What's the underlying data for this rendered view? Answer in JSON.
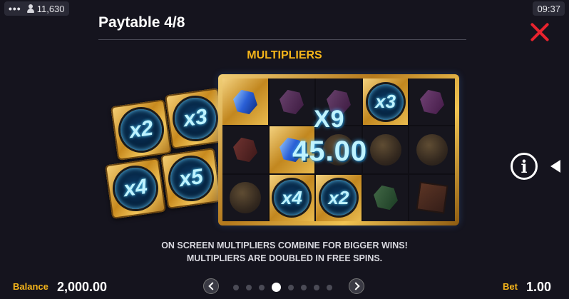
{
  "status": {
    "dots": "•••",
    "credits": "11,630",
    "time": "09:37"
  },
  "header": {
    "title": "Paytable 4/8"
  },
  "section": {
    "heading": "MULTIPLIERS"
  },
  "symbols": {
    "x2": "x2",
    "x3": "x3",
    "x4": "x4",
    "x5": "x5"
  },
  "win": {
    "multiplier": "X9",
    "amount": "45.00"
  },
  "grid": {
    "coin_x3": "x3",
    "coin_x4": "x4",
    "coin_x2": "x2"
  },
  "description": {
    "line1": "ON SCREEN MULTIPLIERS COMBINE FOR BIGGER WINS!",
    "line2": "MULTIPLIERS ARE DOUBLED IN FREE SPINS."
  },
  "footer": {
    "balance_label": "Balance",
    "balance_value": "2,000.00",
    "bet_label": "Bet",
    "bet_value": "1.00"
  },
  "pagination": {
    "total": 8,
    "current": 4
  },
  "colors": {
    "accent": "#f4b41a",
    "close": "#e8232e",
    "glow": "#59d4ff"
  }
}
